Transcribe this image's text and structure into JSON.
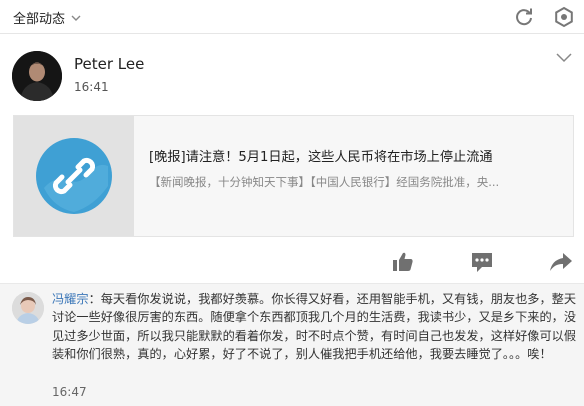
{
  "topbar": {
    "filter_label": "全部动态",
    "filter_icon": "chevron-down-icon",
    "refresh_icon": "refresh-icon",
    "settings_icon": "settings-icon"
  },
  "post": {
    "author": "Peter Lee",
    "time": "16:41",
    "menu_icon": "chevron-down-icon",
    "card": {
      "title": "[晚报]请注意！5月1日起，这些人民币将在市场上停止流通",
      "description": "【新闻晚报，十分钟知天下事】【中国人民银行】经国务院批准，央...",
      "thumb_icon": "link-icon"
    },
    "actions": [
      "like-icon",
      "comment-icon",
      "share-icon"
    ]
  },
  "comment": {
    "author": "冯耀宗",
    "separator": "：",
    "text": "每天看你发说说，我都好羡慕。你长得又好看，还用智能手机，又有钱，朋友也多，整天讨论一些好像很厉害的东西。随便拿个东西都顶我几个月的生活费，我读书少，又是乡下来的，没见过多少世面，所以我只能默默的看着你发，时不时点个赞，有时间自己也发发，这样好像可以假装和你们很熟，真的，心好累，好了不说了，别人催我把手机还给他，我要去睡觉了。。。唉！",
    "time": "16:47"
  },
  "colors": {
    "link_blue": "#3a76b8",
    "icon_gray": "#707070",
    "thumb_circle": "#3fa0d4"
  }
}
